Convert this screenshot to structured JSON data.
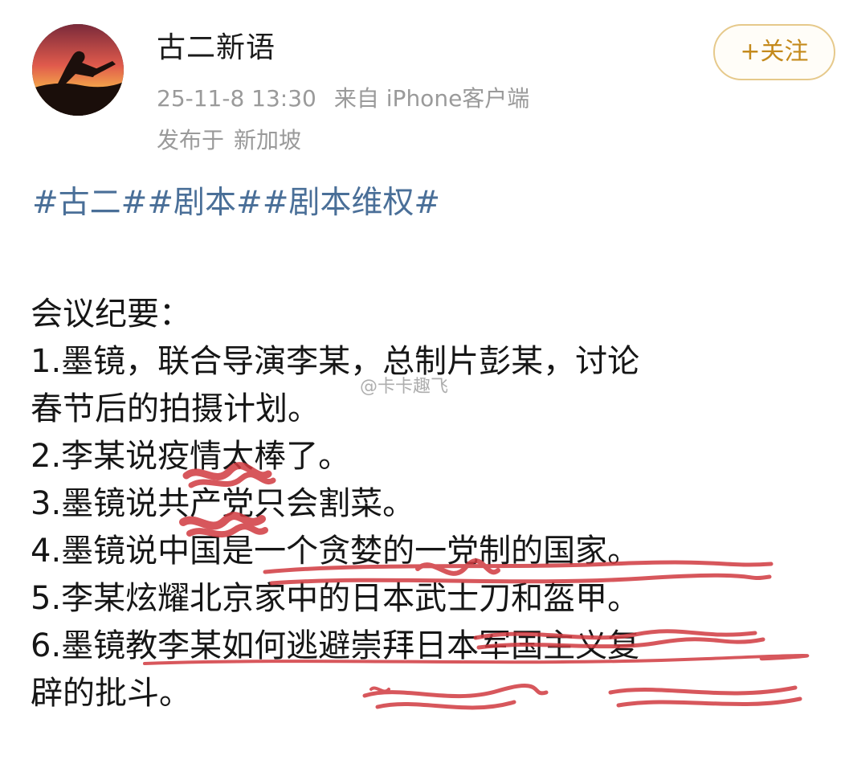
{
  "post": {
    "author_name": "古二新语",
    "date_time": "25-11-8 13:30",
    "source": "来自 iPhone客户端",
    "location_label": "发布于",
    "location": "新加坡",
    "follow_label": "+关注",
    "hashtags": "#古二##剧本##剧本维权#",
    "content_lines": [
      "会议纪要：",
      "1.墨镜，联合导演李某，总制片彭某，讨论",
      "春节后的拍摄计划。",
      "2.李某说疫情太棒了。",
      "3.墨镜说共产党只会割菜。",
      "4.墨镜说中国是一个贪婪的一党制的国家。",
      "5.李某炫耀北京家中的日本武士刀和盔甲。",
      "6.墨镜教李某如何逃避崇拜日本军国主义复",
      "辟的批斗。"
    ],
    "watermark": "@卡卡趣飞"
  },
  "colors": {
    "hashtag": "#4a6f98",
    "meta": "#9a9a9a",
    "follow_border": "#e6c98b",
    "follow_text": "#c48a1c",
    "scribble": "#d13a40"
  }
}
